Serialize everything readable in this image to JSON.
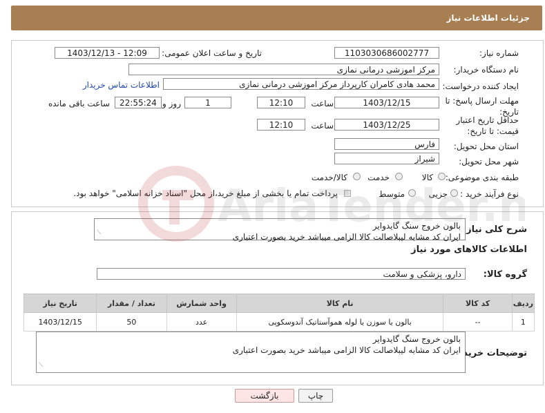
{
  "header": {
    "title": "جزئیات اطلاعات نیاز"
  },
  "fields": {
    "need_number_label": "شماره نیاز:",
    "need_number": "1103030686002777",
    "announce_label": "تاریخ و ساعت اعلان عمومی:",
    "announce_value": "1403/12/13 - 12:09",
    "buyer_org_label": "نام دستگاه خریدار:",
    "buyer_org": "مرکز اموزشی درمانی نمازی",
    "creator_label": "ایجاد کننده درخواست:",
    "creator": "محمد هادی کامران کارپرداز مرکز اموزشی درمانی نمازی",
    "contact_link": "اطلاعات تماس خریدار",
    "deadline_label": "مهلت ارسال پاسخ: تا تاریخ:",
    "deadline_date": "1403/12/15",
    "time_label": "ساعت",
    "deadline_time": "12:10",
    "days_value": "1",
    "days_label": "روز و",
    "remaining_time": "22:55:24",
    "remaining_label": "ساعت باقی مانده",
    "price_validity_label": "حداقل تاریخ اعتبار قیمت: تا تاریخ:",
    "validity_date": "1403/12/25",
    "validity_time": "12:10",
    "province_label": "استان محل تحویل:",
    "province": "فارس",
    "city_label": "شهر محل تحویل:",
    "city": "شیراز",
    "category_label": "طبقه بندی موضوعی:",
    "category_options": [
      "کالا",
      "خدمت",
      "کالا/خدمت"
    ],
    "purchase_type_label": "نوع فرآیند خرید :",
    "purchase_options": [
      "جزیی",
      "متوسط"
    ],
    "payment_note": "پرداخت تمام یا بخشی از مبلغ خرید،از محل \"اسناد خزانه اسلامی\" خواهد بود."
  },
  "description": {
    "label": "شرح کلی نیاز:",
    "line1": "بالون خروج سنگ گایدوایر",
    "line2": "ایران کد مشابه لیبلاصالت کالا الزامی میباشد خرید بصورت اعتباری"
  },
  "goods": {
    "section_title": "اطلاعات کالاهای مورد نیاز",
    "group_label": "گروه کالا:",
    "group_value": "دارو، پزشکی و سلامت",
    "columns": [
      "ردیف",
      "کد کالا",
      "نام کالا",
      "واحد شمارش",
      "تعداد / مقدار",
      "تاریخ نیاز"
    ],
    "rows": [
      [
        "1",
        "--",
        "بالون یا سوزن یا لوله هموآستاتیک آندوسکوپی",
        "عدد",
        "50",
        "1403/12/15"
      ]
    ]
  },
  "buyer_notes": {
    "label": "توضیحات خریدار:",
    "line1": "بالون خروج سنگ گایدوایر",
    "line2": "ایران کد مشابه لیبلاصالت کالا الزامی میباشد خرید بصورت اعتباری"
  },
  "buttons": {
    "back": "بازگشت",
    "print": "چاپ"
  },
  "watermark_text": "AriaTender.neT"
}
